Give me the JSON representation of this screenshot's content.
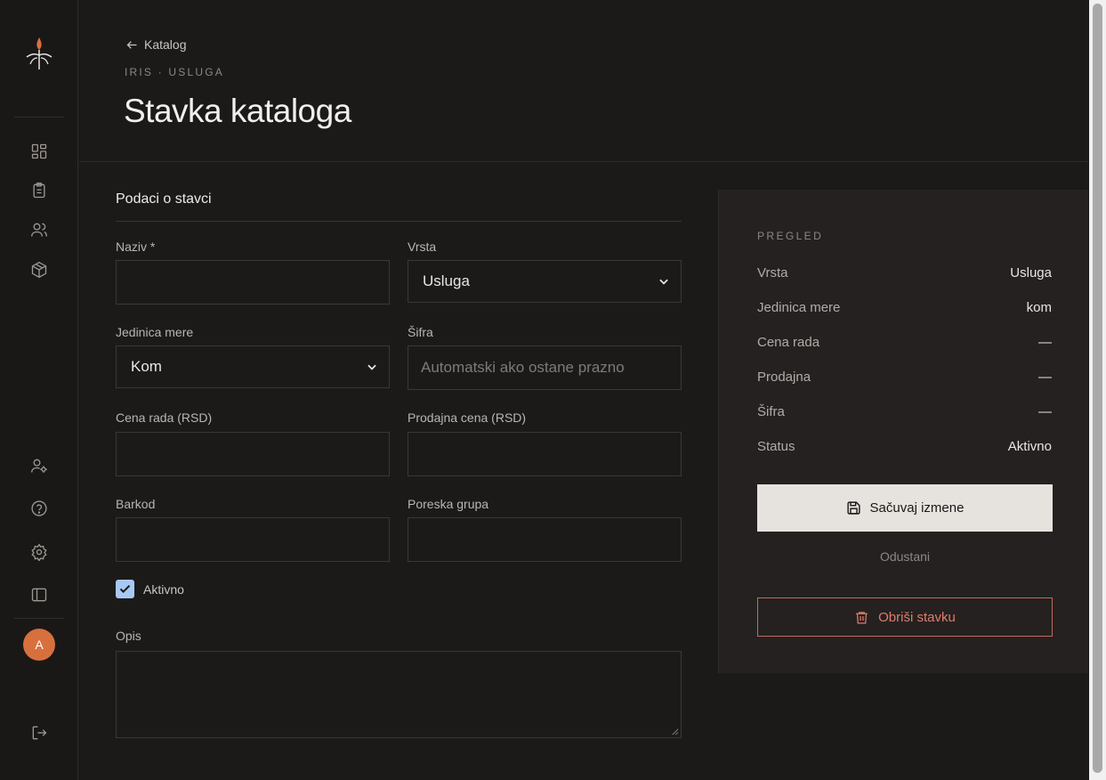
{
  "sidebar": {
    "nav_icons": [
      "dashboard-icon",
      "clipboard-icon",
      "users-icon",
      "package-icon"
    ],
    "bottom_icons": [
      "user-settings-icon",
      "help-icon",
      "settings-icon",
      "sidebar-toggle-icon"
    ],
    "avatar_initial": "A",
    "logout_icon": "logout-icon"
  },
  "header": {
    "back_label": "Katalog",
    "eyebrow": "IRIS · USLUGA",
    "title": "Stavka kataloga"
  },
  "form": {
    "section_title": "Podaci o stavci",
    "naziv_label": "Naziv *",
    "naziv_value": "",
    "vrsta_label": "Vrsta",
    "vrsta_value": "Usluga",
    "jedinica_label": "Jedinica mere",
    "jedinica_value": "Kom",
    "sifra_label": "Šifra",
    "sifra_placeholder": "Automatski ako ostane prazno",
    "cena_rada_label": "Cena rada (RSD)",
    "prodajna_label": "Prodajna cena (RSD)",
    "barkod_label": "Barkod",
    "poreska_label": "Poreska grupa",
    "aktivno_label": "Aktivno",
    "aktivno_checked": true,
    "opis_label": "Opis"
  },
  "overview": {
    "eyebrow": "PREGLED",
    "rows": [
      {
        "key": "Vrsta",
        "value": "Usluga"
      },
      {
        "key": "Jedinica mere",
        "value": "kom"
      },
      {
        "key": "Cena rada",
        "value": "—"
      },
      {
        "key": "Prodajna",
        "value": "—"
      },
      {
        "key": "Šifra",
        "value": "—"
      },
      {
        "key": "Status",
        "value": "Aktivno"
      }
    ],
    "save_label": "Sačuvaj izmene",
    "cancel_label": "Odustani",
    "delete_label": "Obriši stavku"
  },
  "colors": {
    "background": "#1c1a19",
    "panel": "#242120",
    "accent": "#d8703e",
    "danger": "#e27b6d",
    "checkbox": "#a8c8f4"
  }
}
